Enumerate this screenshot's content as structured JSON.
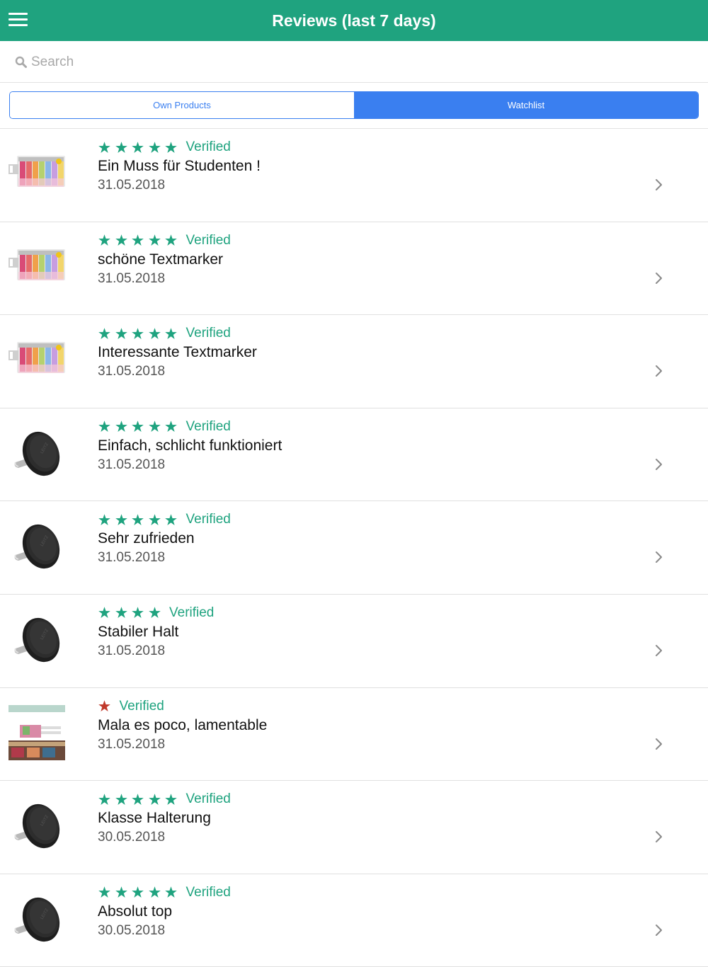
{
  "header": {
    "title": "Reviews (last 7 days)"
  },
  "search": {
    "placeholder": "Search"
  },
  "tabs": {
    "own": "Own Products",
    "watchlist": "Watchlist",
    "selected": "Watchlist"
  },
  "colors": {
    "brand": "#1fa37f",
    "accent": "#3a7ff0",
    "star": "#1fa37f",
    "star_low": "#c0392b",
    "verified": "#1fa37f"
  },
  "reviews": [
    {
      "thumbnail": "highlighter-pack-icon",
      "stars": 5,
      "verified": "Verified",
      "title": "Ein Muss für Studenten !",
      "date": "31.05.2018"
    },
    {
      "thumbnail": "highlighter-pack-icon",
      "stars": 5,
      "verified": "Verified",
      "title": "schöne Textmarker",
      "date": "31.05.2018"
    },
    {
      "thumbnail": "highlighter-pack-icon",
      "stars": 5,
      "verified": "Verified",
      "title": "Interessante Textmarker",
      "date": "31.05.2018"
    },
    {
      "thumbnail": "magnetic-phone-holder-icon",
      "stars": 5,
      "verified": "Verified",
      "title": "Einfach, schlicht funktioniert",
      "date": "31.05.2018"
    },
    {
      "thumbnail": "magnetic-phone-holder-icon",
      "stars": 5,
      "verified": "Verified",
      "title": "Sehr zufrieden",
      "date": "31.05.2018"
    },
    {
      "thumbnail": "magnetic-phone-holder-icon",
      "stars": 4,
      "verified": "Verified",
      "title": "Stabiler Halt",
      "date": "31.05.2018"
    },
    {
      "thumbnail": "product-photo-icon",
      "stars": 1,
      "verified": "Verified",
      "title": "Mala es poco, lamentable",
      "date": "31.05.2018"
    },
    {
      "thumbnail": "magnetic-phone-holder-icon",
      "stars": 5,
      "verified": "Verified",
      "title": "Klasse Halterung",
      "date": "30.05.2018"
    },
    {
      "thumbnail": "magnetic-phone-holder-icon",
      "stars": 5,
      "verified": "Verified",
      "title": "Absolut top",
      "date": "30.05.2018"
    }
  ]
}
